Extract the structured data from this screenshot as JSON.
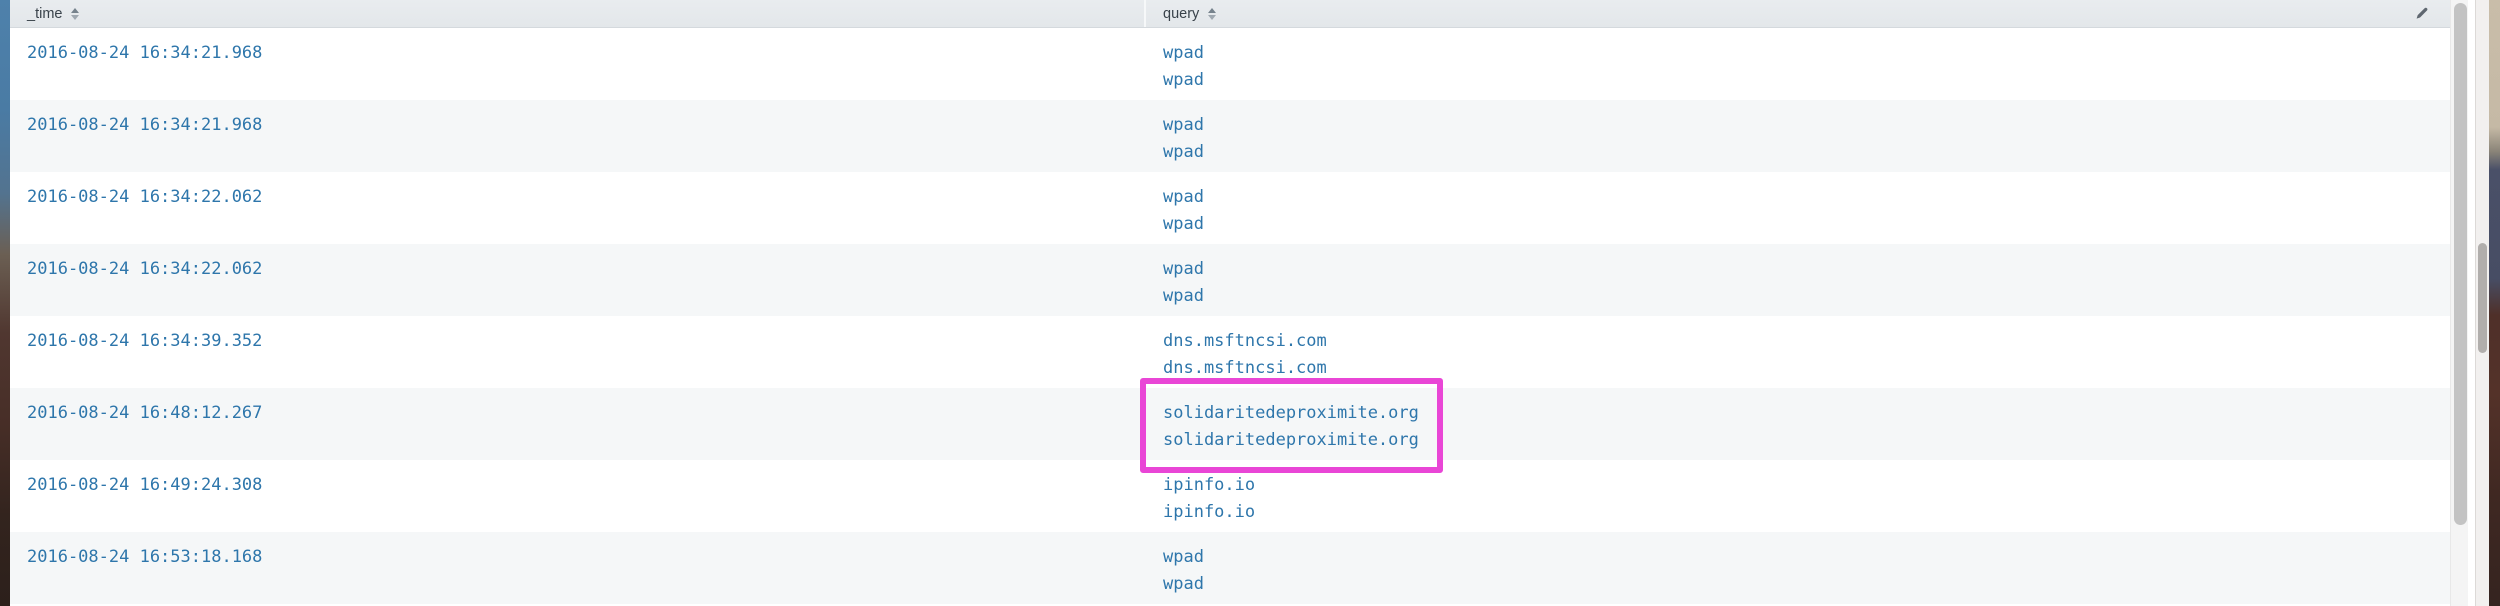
{
  "table": {
    "columns": [
      {
        "label": "_time"
      },
      {
        "label": "query"
      }
    ],
    "rows": [
      {
        "time": "2016-08-24 16:34:21.968",
        "query": [
          "wpad",
          "wpad"
        ]
      },
      {
        "time": "2016-08-24 16:34:21.968",
        "query": [
          "wpad",
          "wpad"
        ]
      },
      {
        "time": "2016-08-24 16:34:22.062",
        "query": [
          "wpad",
          "wpad"
        ]
      },
      {
        "time": "2016-08-24 16:34:22.062",
        "query": [
          "wpad",
          "wpad"
        ]
      },
      {
        "time": "2016-08-24 16:34:39.352",
        "query": [
          "dns.msftncsi.com",
          "dns.msftncsi.com"
        ]
      },
      {
        "time": "2016-08-24 16:48:12.267",
        "query": [
          "solidaritedeproximite.org",
          "solidaritedeproximite.org"
        ],
        "highlighted": true
      },
      {
        "time": "2016-08-24 16:49:24.308",
        "query": [
          "ipinfo.io",
          "ipinfo.io"
        ]
      },
      {
        "time": "2016-08-24 16:53:18.168",
        "query": [
          "wpad",
          "wpad"
        ]
      }
    ]
  },
  "icons": {
    "sort": "sort-arrows",
    "edit": "pencil"
  },
  "colors": {
    "link_blue": "#2e76ab",
    "highlight_magenta": "#e946d6",
    "row_stripe": "#f5f7f8",
    "header_bg": "#e7eaed"
  }
}
